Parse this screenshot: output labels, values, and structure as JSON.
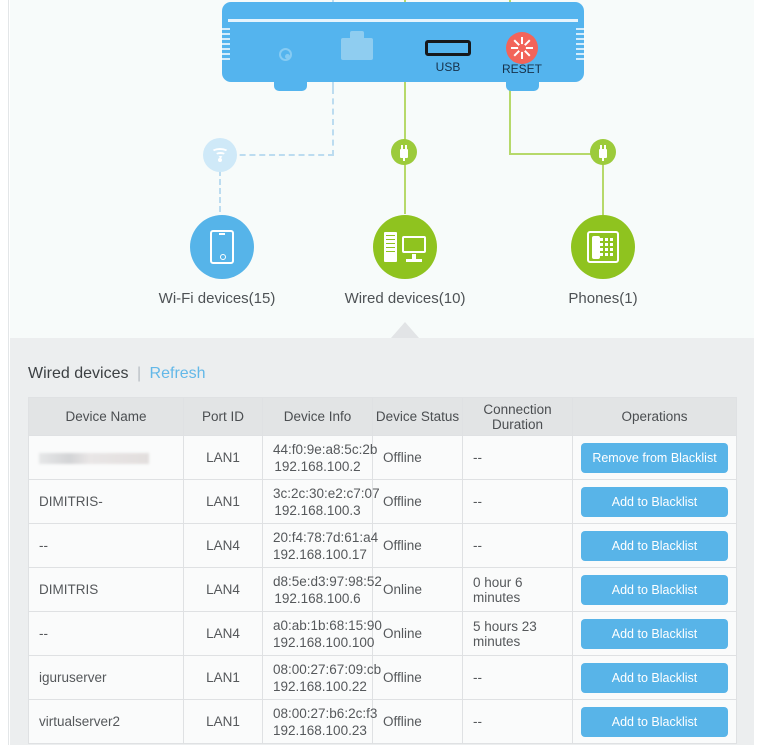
{
  "topology": {
    "router": {
      "usb_label": "USB",
      "reset_label": "RESET",
      "power_icon": "power-port-icon",
      "ethernet_icon": "ethernet-port-icon",
      "usb_icon": "usb-port-icon",
      "reset_icon": "reset-button-icon"
    },
    "nodes": [
      {
        "id": "wifi",
        "label": "Wi-Fi devices(15)",
        "icon": "tablet-icon",
        "color": "#56b4e9",
        "link": "dashed"
      },
      {
        "id": "wired",
        "label": "Wired devices(10)",
        "icon": "desktop-pc-icon",
        "color": "#8fc31f",
        "link": "solid"
      },
      {
        "id": "phone",
        "label": "Phones(1)",
        "icon": "desk-phone-icon",
        "color": "#8fc31f",
        "link": "solid"
      }
    ]
  },
  "panel": {
    "title": "Wired devices",
    "separator": "|",
    "refresh_label": "Refresh"
  },
  "table": {
    "columns": [
      "Device Name",
      "Port ID",
      "Device Info",
      "Device Status",
      "Connection Duration",
      "Operations"
    ],
    "rows": [
      {
        "name": "",
        "redacted": true,
        "port": "LAN1",
        "mac": "44:f0:9e:a8:5c:2b",
        "ip": "192.168.100.2",
        "status": "Offline",
        "duration": "--",
        "action": "Remove from Blacklist"
      },
      {
        "name": "DIMITRIS-",
        "port": "LAN1",
        "mac": "3c:2c:30:e2:c7:07",
        "ip": "192.168.100.3",
        "status": "Offline",
        "duration": "--",
        "action": "Add to Blacklist"
      },
      {
        "name": "--",
        "port": "LAN4",
        "mac": "20:f4:78:7d:61:a4",
        "ip": "192.168.100.17",
        "status": "Offline",
        "duration": "--",
        "action": "Add to Blacklist"
      },
      {
        "name": "DIMITRIS",
        "port": "LAN4",
        "mac": "d8:5e:d3:97:98:52",
        "ip": "192.168.100.6",
        "status": "Online",
        "duration": "0 hour 6 minutes",
        "action": "Add to Blacklist"
      },
      {
        "name": "--",
        "port": "LAN4",
        "mac": "a0:ab:1b:68:15:90",
        "ip": "192.168.100.100",
        "status": "Online",
        "duration": "5 hours 23 minutes",
        "action": "Add to Blacklist"
      },
      {
        "name": "iguruserver",
        "port": "LAN1",
        "mac": "08:00:27:67:09:cb",
        "ip": "192.168.100.22",
        "status": "Offline",
        "duration": "--",
        "action": "Add to Blacklist"
      },
      {
        "name": "virtualserver2",
        "port": "LAN1",
        "mac": "08:00:27:b6:2c:f3",
        "ip": "192.168.100.23",
        "status": "Offline",
        "duration": "--",
        "action": "Add to Blacklist"
      }
    ]
  },
  "colors": {
    "accent_blue": "#58b4e8",
    "accent_green": "#8fc31f",
    "reset_red": "#f2645a",
    "panel_bg": "#eceeef",
    "topology_bg": "#f7fbfa"
  }
}
